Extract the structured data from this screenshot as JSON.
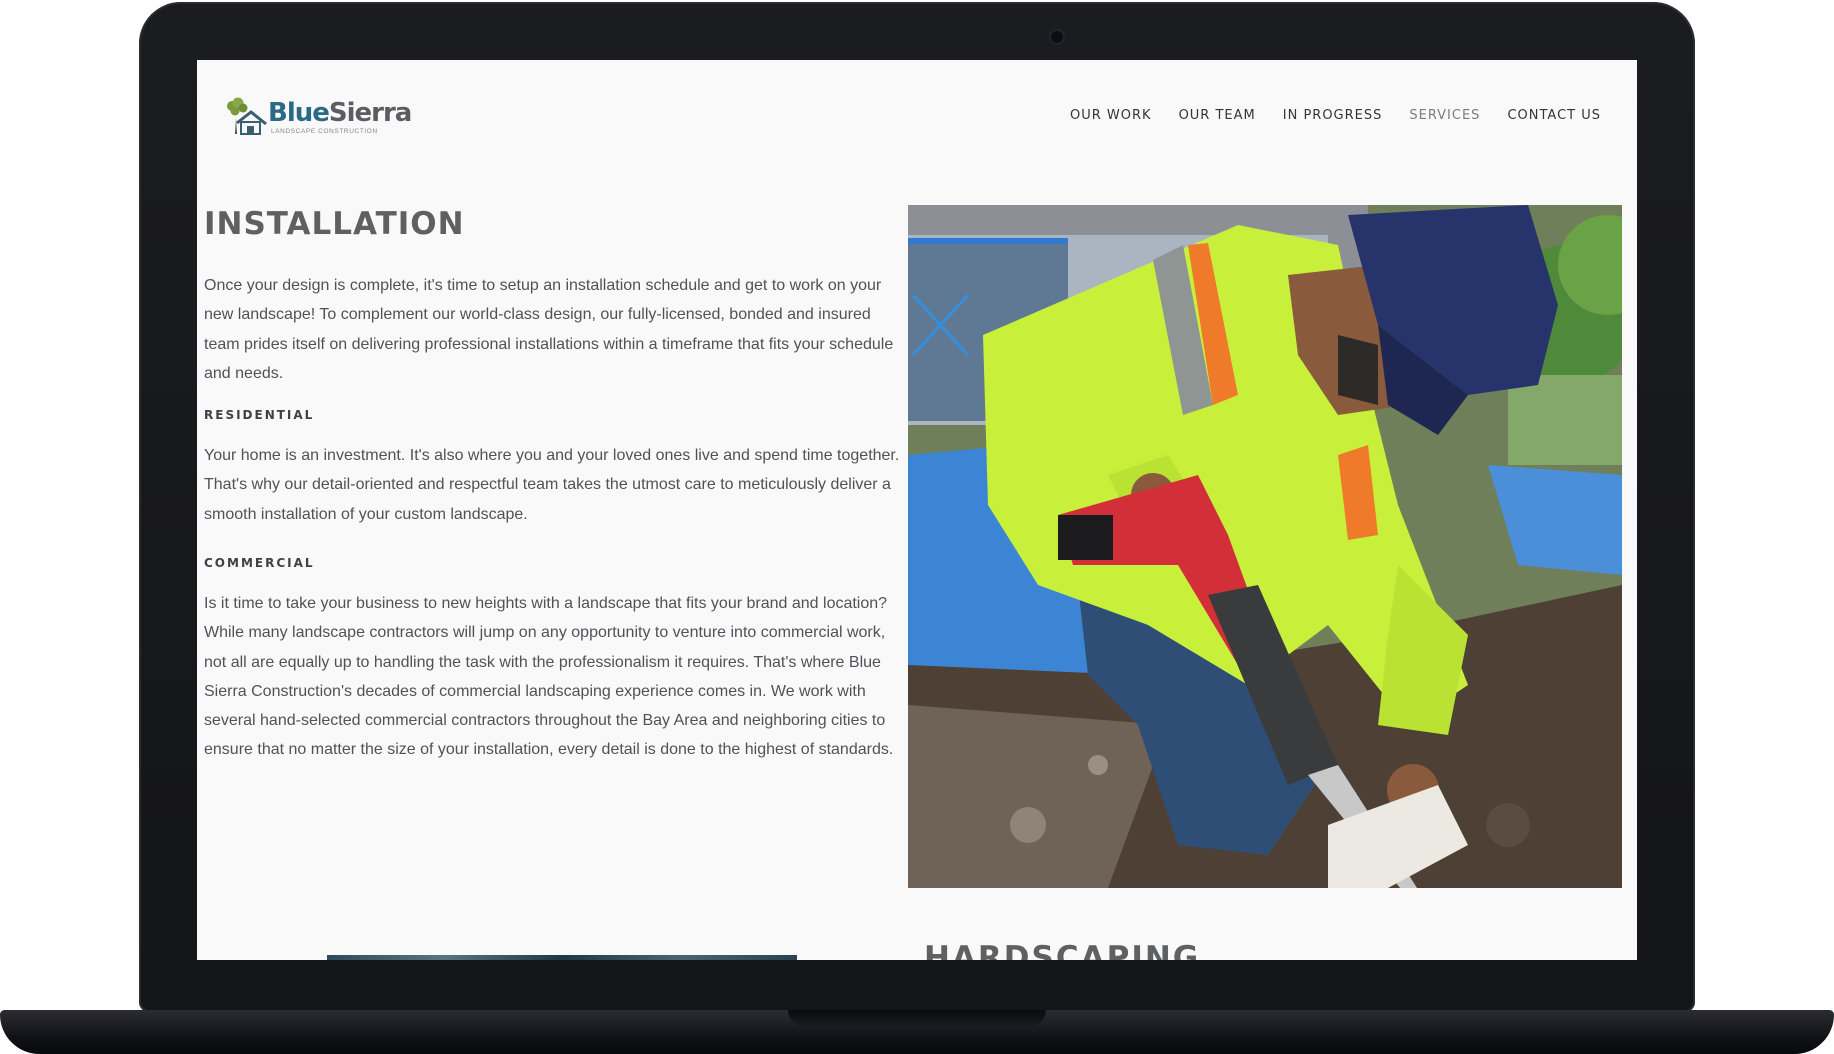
{
  "site": {
    "logo": {
      "word1": "Blue",
      "word2": "Sierra",
      "tagline": "LANDSCAPE CONSTRUCTION"
    },
    "nav": [
      {
        "label": "OUR WORK",
        "active": false
      },
      {
        "label": "OUR TEAM",
        "active": false
      },
      {
        "label": "IN PROGRESS",
        "active": false
      },
      {
        "label": "SERVICES",
        "active": true
      },
      {
        "label": "CONTACT US",
        "active": false
      }
    ]
  },
  "installation": {
    "title": "INSTALLATION",
    "intro": "Once your design is complete, it's time to setup an installation schedule and get to work on your new landscape! To complement our world-class design, our fully-licensed, bonded and insured team prides itself on delivering professional installations within a timeframe that fits your schedule and needs.",
    "residential_title": "RESIDENTIAL",
    "residential_text": "Your home is an investment. It's also where you and your loved ones live and spend time together. That's why our detail-oriented and respectful team takes the utmost care to meticulously deliver a smooth installation of your custom landscape.",
    "commercial_title": "COMMERCIAL",
    "commercial_text": "Is it time to take your business to new heights with a landscape that fits your brand and location? While many landscape contractors will jump on any opportunity to venture into commercial work, not all are equally up to handling the task with the professionalism it requires. That's where Blue Sierra Construction's decades of commercial landscaping experience comes in. We work with several hand-selected commercial contractors throughout the Bay Area and neighboring cities to ensure that no matter the size of your installation, every detail is done to the highest of standards."
  },
  "next_section": {
    "title": "HARDSCAPING"
  },
  "colors": {
    "screen_bg": "#f9f9f9",
    "brand_blue": "#2b6a86",
    "heading": "#5f6062",
    "body_text": "#505257",
    "vest": "#c8f03a",
    "cap": "#27346b",
    "tarp": "#3f88d6"
  },
  "icons": [
    "house-tree-logo-icon",
    "camera-icon"
  ]
}
